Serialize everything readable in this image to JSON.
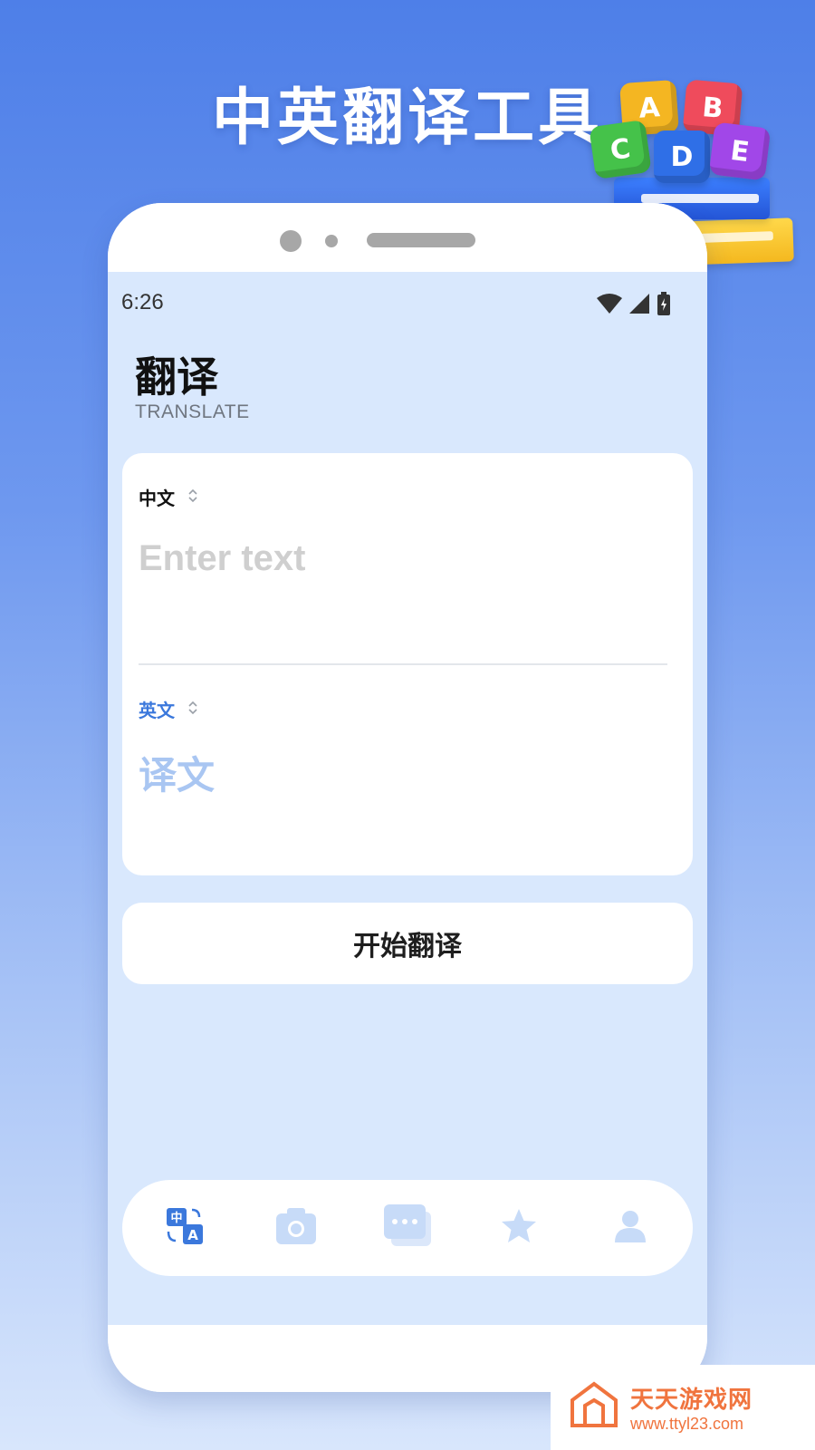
{
  "promo": {
    "title": "中英翻译工具",
    "blocks": [
      "A",
      "B",
      "C",
      "D",
      "E"
    ]
  },
  "status_bar": {
    "time": "6:26",
    "icons": [
      "wifi-icon",
      "signal-icon",
      "battery-icon"
    ]
  },
  "header": {
    "title": "翻译",
    "subtitle": "TRANSLATE"
  },
  "translator": {
    "source_language": "中文",
    "source_placeholder": "Enter text",
    "source_value": "",
    "target_language": "英文",
    "result_placeholder": "译文"
  },
  "actions": {
    "translate_label": "开始翻译"
  },
  "bottom_nav": {
    "items": [
      {
        "icon": "translate-icon",
        "active": true
      },
      {
        "icon": "camera-icon",
        "active": false
      },
      {
        "icon": "chat-icon",
        "active": false
      },
      {
        "icon": "star-icon",
        "active": false
      },
      {
        "icon": "user-icon",
        "active": false
      }
    ]
  },
  "watermark": {
    "text": "天天游戏网",
    "url": "www.ttyl23.com"
  },
  "colors": {
    "background_top": "#4e7fe8",
    "screen_bg": "#d9e8fd",
    "accent": "#3b78dc",
    "inactive_icon": "#c7dbf8",
    "watermark": "#f0743e"
  }
}
